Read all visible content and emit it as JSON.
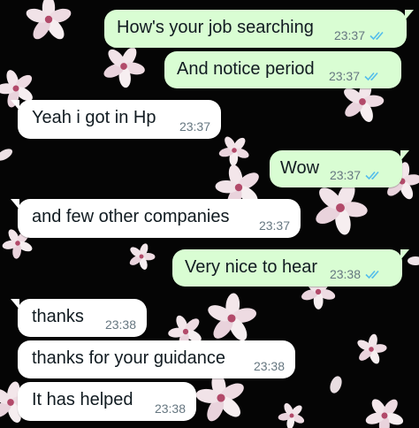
{
  "colors": {
    "outgoing_bubble": "#d9fdd3",
    "incoming_bubble": "#ffffff",
    "read_ticks": "#53bdeb",
    "timestamp": "#667781",
    "wallpaper": "#050505"
  },
  "messages": [
    {
      "direction": "out",
      "text": "How's your job searching",
      "time": "23:37",
      "status": "read-ticks-icon"
    },
    {
      "direction": "out",
      "text": "And notice period",
      "time": "23:37",
      "status": "read-ticks-icon"
    },
    {
      "direction": "in",
      "text": "Yeah i got in Hp",
      "time": "23:37"
    },
    {
      "direction": "out",
      "text": "Wow",
      "time": "23:37",
      "status": "read-ticks-icon"
    },
    {
      "direction": "in",
      "text": "and few other companies",
      "time": "23:37"
    },
    {
      "direction": "out",
      "text": "Very nice to hear",
      "time": "23:38",
      "status": "read-ticks-icon"
    },
    {
      "direction": "in",
      "text": "thanks",
      "time": "23:38"
    },
    {
      "direction": "in",
      "text": "thanks for your guidance",
      "time": "23:38"
    },
    {
      "direction": "in",
      "text": "It has helped",
      "time": "23:38"
    }
  ]
}
